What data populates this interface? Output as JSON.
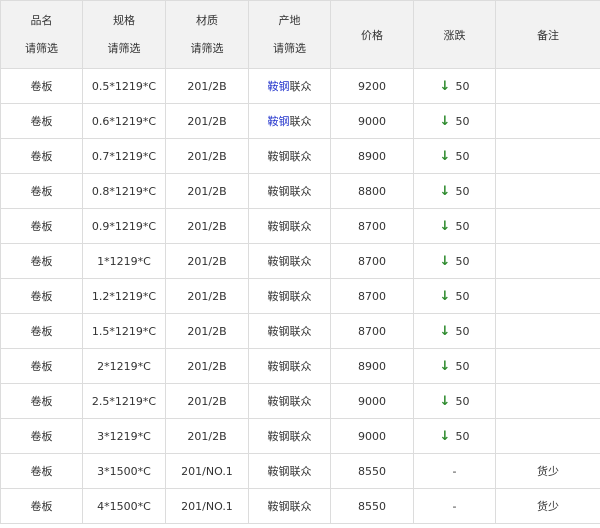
{
  "header": {
    "name": {
      "label": "品名",
      "filter": "请筛选"
    },
    "spec": {
      "label": "规格",
      "filter": "请筛选"
    },
    "material": {
      "label": "材质",
      "filter": "请筛选"
    },
    "origin": {
      "label": "产地",
      "filter": "请筛选"
    },
    "price": {
      "label": "价格"
    },
    "change": {
      "label": "涨跌"
    },
    "note": {
      "label": "备注"
    }
  },
  "icons": {
    "down": "arrow-down-icon"
  },
  "colors": {
    "down": "#2d8a2d",
    "link": "#2233cc",
    "header_bg": "#f2f2f2",
    "border": "#dcdcdc"
  },
  "rows": [
    {
      "name": "卷板",
      "spec": "0.5*1219*C",
      "material": "201/2B",
      "origin": "鞍钢联众",
      "origin_link_part": "鞍钢",
      "origin_rest": "联众",
      "origin_highlight": true,
      "price": "9200",
      "change_dir": "down",
      "change": "50",
      "note": ""
    },
    {
      "name": "卷板",
      "spec": "0.6*1219*C",
      "material": "201/2B",
      "origin": "鞍钢联众",
      "origin_link_part": "鞍钢",
      "origin_rest": "联众",
      "origin_highlight": true,
      "price": "9000",
      "change_dir": "down",
      "change": "50",
      "note": ""
    },
    {
      "name": "卷板",
      "spec": "0.7*1219*C",
      "material": "201/2B",
      "origin": "鞍钢联众",
      "price": "8900",
      "change_dir": "down",
      "change": "50",
      "note": ""
    },
    {
      "name": "卷板",
      "spec": "0.8*1219*C",
      "material": "201/2B",
      "origin": "鞍钢联众",
      "price": "8800",
      "change_dir": "down",
      "change": "50",
      "note": ""
    },
    {
      "name": "卷板",
      "spec": "0.9*1219*C",
      "material": "201/2B",
      "origin": "鞍钢联众",
      "price": "8700",
      "change_dir": "down",
      "change": "50",
      "note": ""
    },
    {
      "name": "卷板",
      "spec": "1*1219*C",
      "material": "201/2B",
      "origin": "鞍钢联众",
      "price": "8700",
      "change_dir": "down",
      "change": "50",
      "note": ""
    },
    {
      "name": "卷板",
      "spec": "1.2*1219*C",
      "material": "201/2B",
      "origin": "鞍钢联众",
      "price": "8700",
      "change_dir": "down",
      "change": "50",
      "note": ""
    },
    {
      "name": "卷板",
      "spec": "1.5*1219*C",
      "material": "201/2B",
      "origin": "鞍钢联众",
      "price": "8700",
      "change_dir": "down",
      "change": "50",
      "note": ""
    },
    {
      "name": "卷板",
      "spec": "2*1219*C",
      "material": "201/2B",
      "origin": "鞍钢联众",
      "price": "8900",
      "change_dir": "down",
      "change": "50",
      "note": ""
    },
    {
      "name": "卷板",
      "spec": "2.5*1219*C",
      "material": "201/2B",
      "origin": "鞍钢联众",
      "price": "9000",
      "change_dir": "down",
      "change": "50",
      "note": ""
    },
    {
      "name": "卷板",
      "spec": "3*1219*C",
      "material": "201/2B",
      "origin": "鞍钢联众",
      "price": "9000",
      "change_dir": "down",
      "change": "50",
      "note": ""
    },
    {
      "name": "卷板",
      "spec": "3*1500*C",
      "material": "201/NO.1",
      "origin": "鞍钢联众",
      "price": "8550",
      "change_dir": "none",
      "change": "-",
      "note": "货少"
    },
    {
      "name": "卷板",
      "spec": "4*1500*C",
      "material": "201/NO.1",
      "origin": "鞍钢联众",
      "price": "8550",
      "change_dir": "none",
      "change": "-",
      "note": "货少"
    }
  ]
}
